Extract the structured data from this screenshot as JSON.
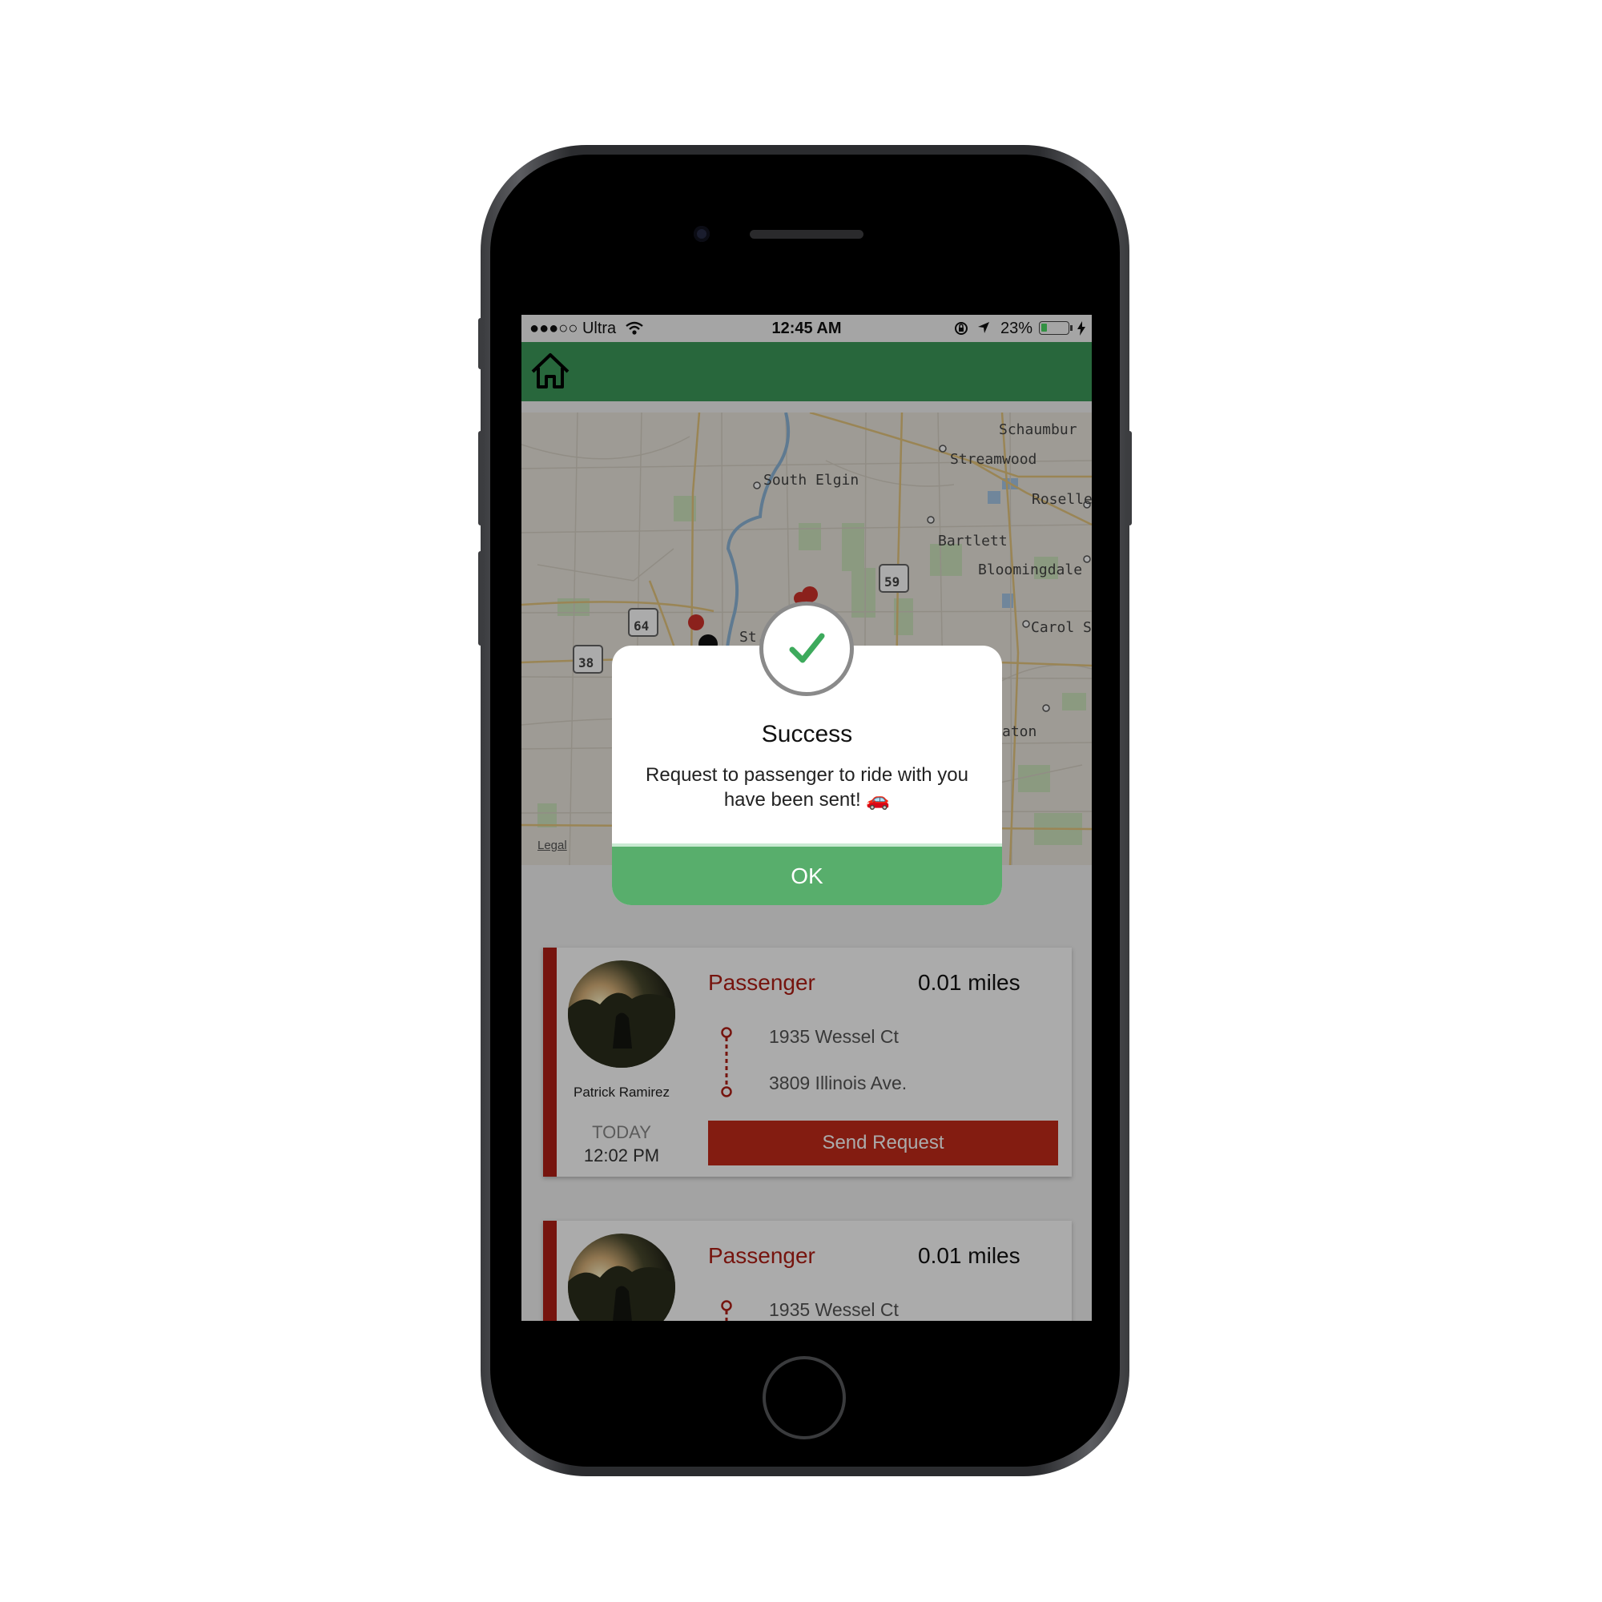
{
  "status_bar": {
    "carrier": "●●●○○ Ultra",
    "time": "12:45 AM",
    "battery": "23%",
    "battery_fraction": 0.23
  },
  "nav": {
    "home_icon": "home-icon",
    "color": "#3d9a5a"
  },
  "map": {
    "labels": [
      "Schaumbur",
      "Streamwood",
      "South Elgin",
      "Roselle",
      "Bartlett",
      "Bloomingdale",
      "Carol St",
      "St.",
      "aton"
    ],
    "route_shields": [
      "59",
      "64",
      "38"
    ],
    "legal": "Legal"
  },
  "rides": [
    {
      "role": "Passenger",
      "distance": "0.01 miles",
      "name": "Patrick Ramirez",
      "from": "1935 Wessel Ct",
      "to": "3809 Illinois Ave.",
      "day": "TODAY",
      "time": "12:02 PM",
      "action": "Send Request"
    },
    {
      "role": "Passenger",
      "distance": "0.01 miles",
      "from": "1935 Wessel Ct"
    }
  ],
  "dialog": {
    "title": "Success",
    "message": "Request to passenger to ride with you have been sent! 🚗",
    "ok_label": "OK",
    "icon": "check-icon"
  },
  "colors": {
    "accent": "#58ae6c",
    "brand_red": "#b01e16",
    "check": "#3daa5c"
  }
}
